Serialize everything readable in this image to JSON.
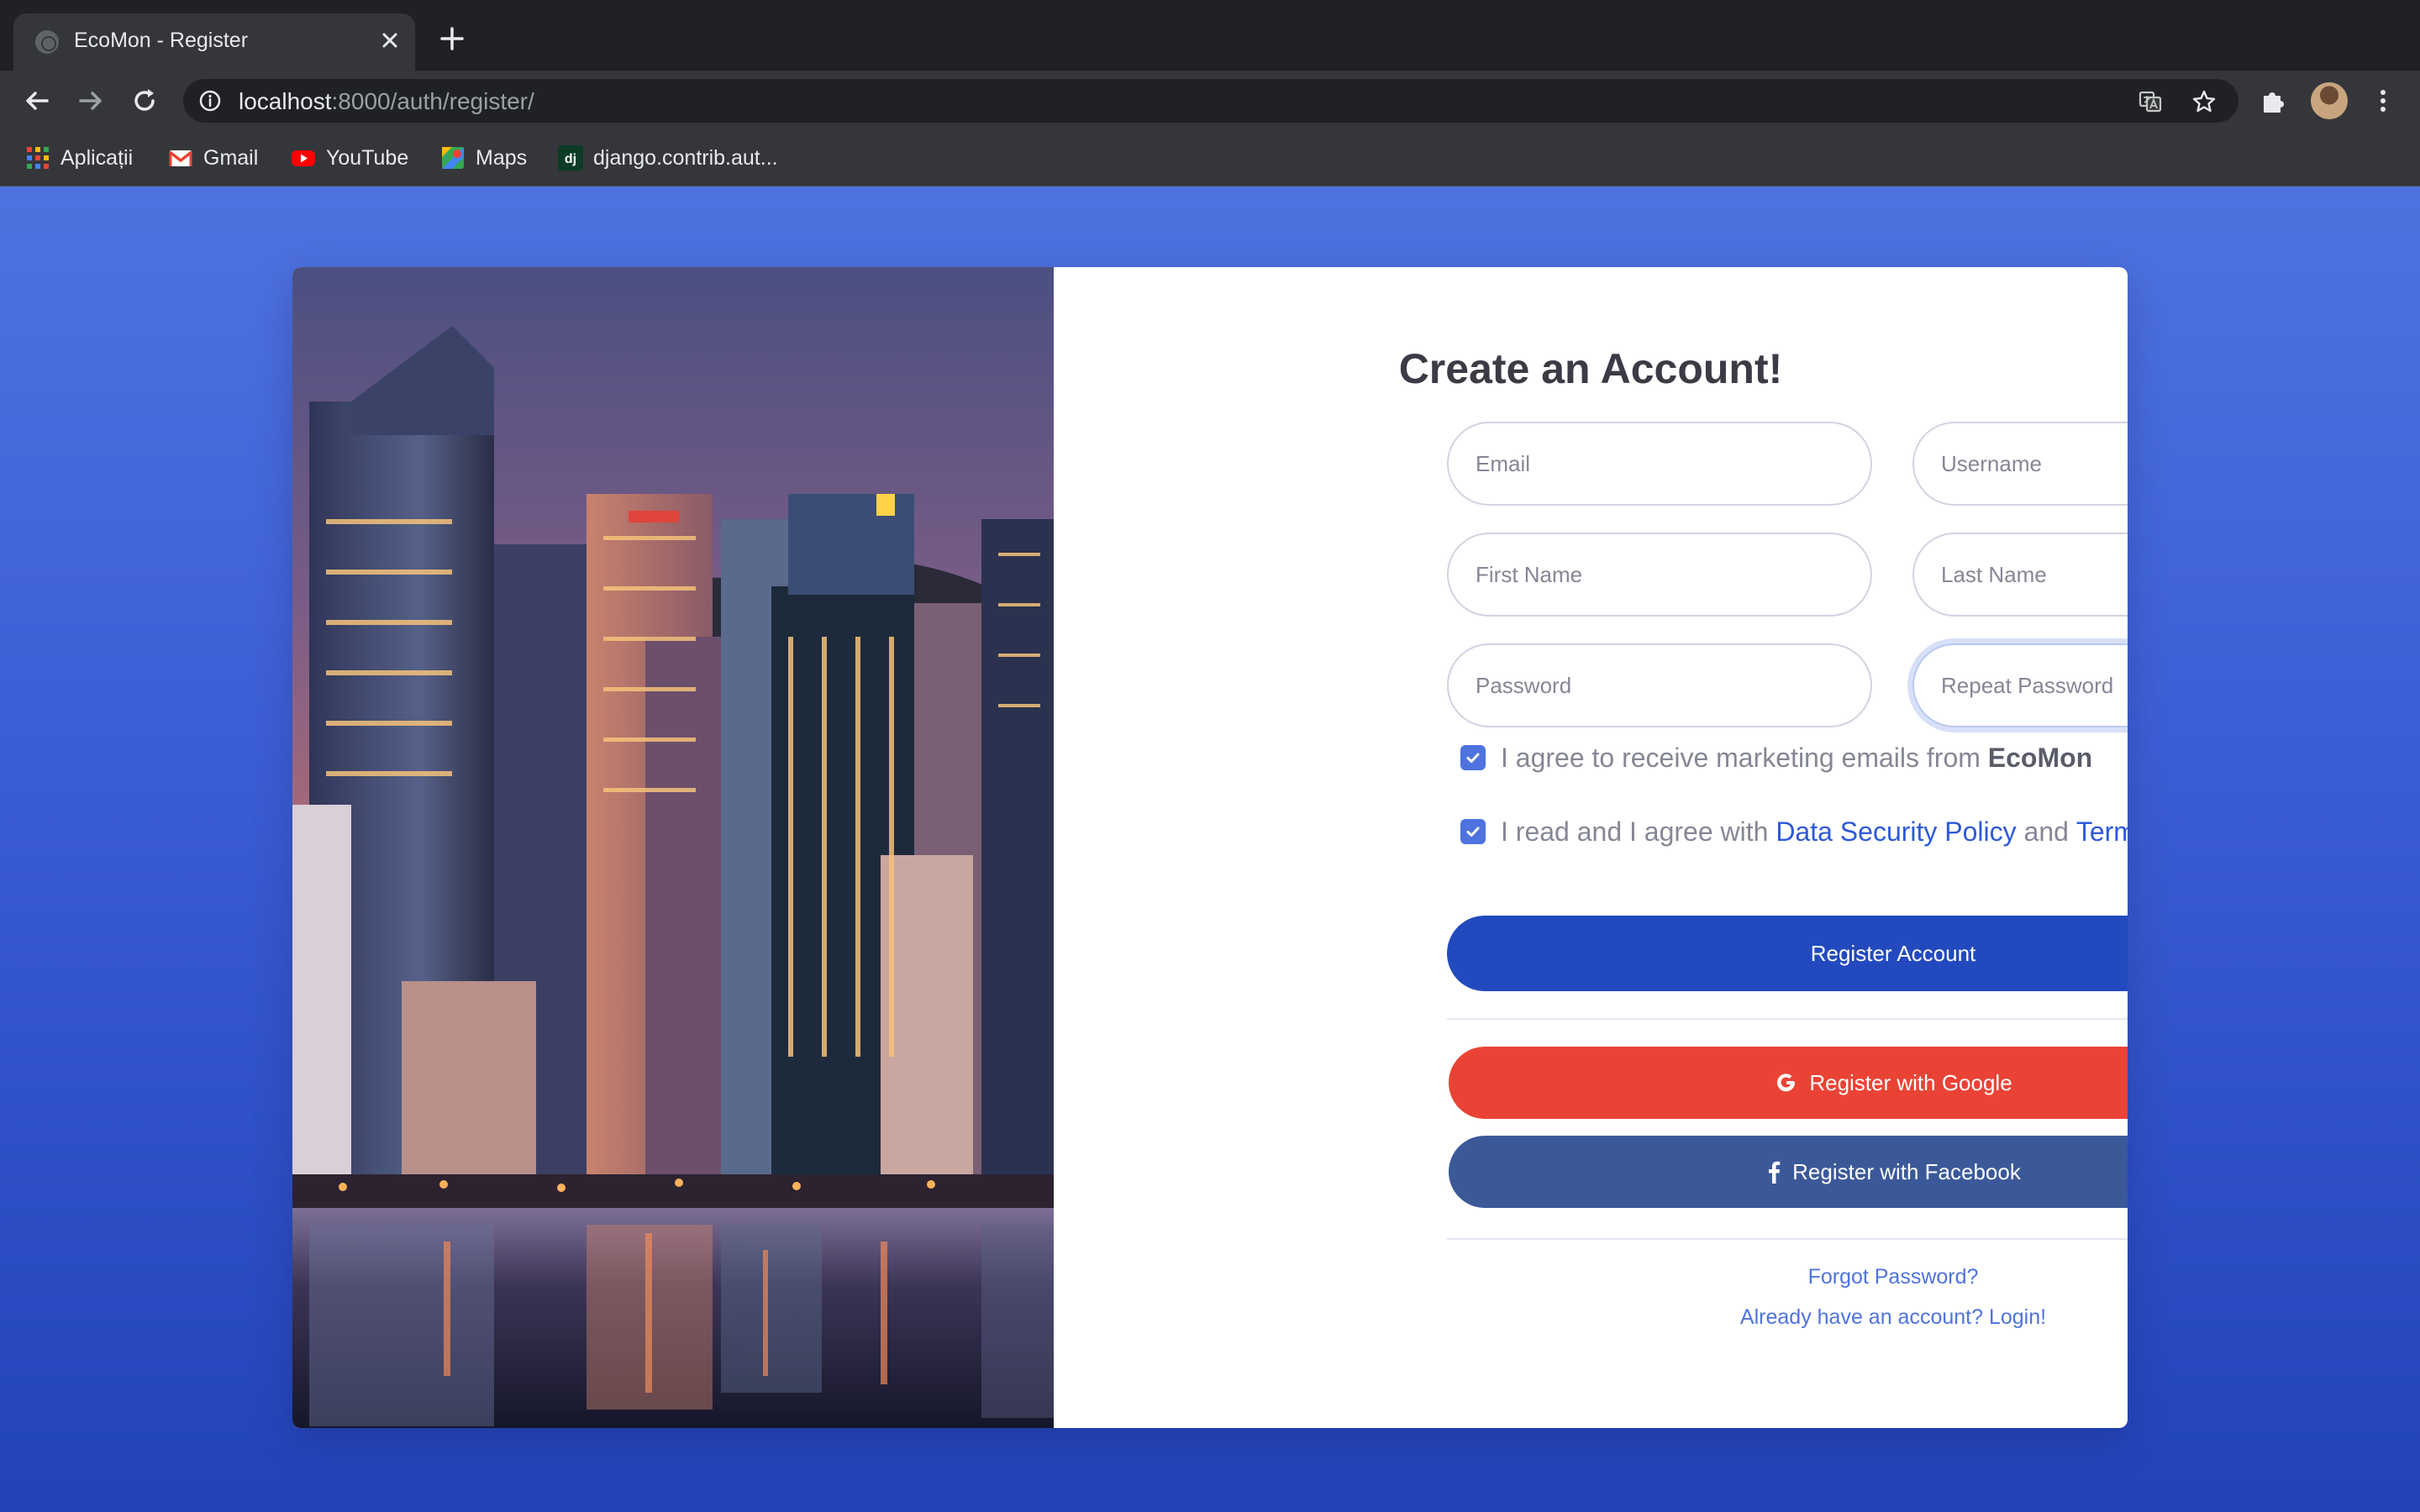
{
  "browser": {
    "tab_title": "EcoMon - Register",
    "url_host": "localhost",
    "url_path": ":8000/auth/register/",
    "bookmarks": [
      "Aplicații",
      "Gmail",
      "YouTube",
      "Maps",
      "django.contrib.aut..."
    ]
  },
  "form": {
    "heading": "Create an Account!",
    "email_placeholder": "Email",
    "username_placeholder": "Username",
    "first_name_placeholder": "First Name",
    "last_name_placeholder": "Last Name",
    "password_placeholder": "Password",
    "repeat_password_placeholder": "Repeat Password",
    "marketing_text": "I agree to receive marketing emails from ",
    "marketing_brand": "EcoMon",
    "marketing_checked": true,
    "terms_text_1": "I read and I agree with ",
    "terms_link_1": "Data Security Policy",
    "terms_text_2": " and ",
    "terms_link_2": "Terms and Conditions",
    "terms_checked": true,
    "register_button": "Register Account",
    "google_button": "Register with Google",
    "facebook_button": "Register with Facebook",
    "forgot_password": "Forgot Password?",
    "login_link": "Already have an account? Login!"
  },
  "colors": {
    "background_top": "#4e73df",
    "background_bottom": "#2243b8",
    "primary_button": "#224abe",
    "google_button": "#ea4335",
    "facebook_button": "#3b5998",
    "link": "#4e73df"
  }
}
